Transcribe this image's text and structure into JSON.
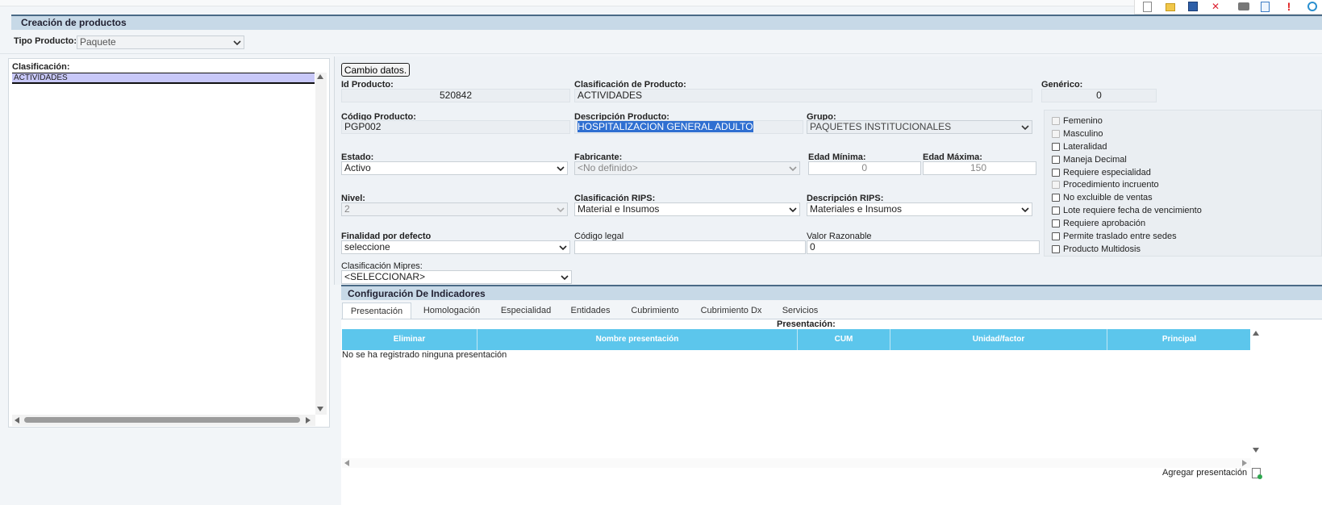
{
  "page": {
    "title": "Creación de productos",
    "tipo_producto_label": "Tipo Producto:",
    "tipo_producto_value": "Paquete"
  },
  "left_panel": {
    "header": "Clasificación:",
    "items": [
      "ACTIVIDADES"
    ]
  },
  "form": {
    "cambio_button": "Cambio datos.",
    "id_producto_label": "Id Producto:",
    "id_producto_value": "520842",
    "clasificacion_producto_label": "Clasificación de Producto:",
    "clasificacion_producto_value": "ACTIVIDADES",
    "generico_label": "Genérico:",
    "generico_value": "0",
    "codigo_label": "Código Producto:",
    "codigo_value": "PGP002",
    "descripcion_label": "Descripción Producto:",
    "descripcion_value": "HOSPITALIZACION GENERAL ADULTO",
    "grupo_label": "Grupo:",
    "grupo_value": "PAQUETES INSTITUCIONALES",
    "estado_label": "Estado:",
    "estado_value": "Activo",
    "fabricante_label": "Fabricante:",
    "fabricante_value": "<No definido>",
    "edad_min_label": "Edad Mínima:",
    "edad_min_value": "0",
    "edad_max_label": "Edad Máxima:",
    "edad_max_value": "150",
    "nivel_label": "Nivel:",
    "nivel_value": "2",
    "clasif_rips_label": "Clasificación RIPS:",
    "clasif_rips_value": "Material e Insumos",
    "desc_rips_label": "Descripción RIPS:",
    "desc_rips_value": "Materiales e Insumos",
    "finalidad_label": "Finalidad por defecto",
    "finalidad_value": "seleccione",
    "codigo_legal_label": "Código legal",
    "codigo_legal_value": "",
    "valor_razonable_label": "Valor Razonable",
    "valor_razonable_value": "0",
    "mipres_label": "Clasificación Mipres:",
    "mipres_value": "<SELECCIONAR>"
  },
  "checkboxes": [
    {
      "label": "Femenino",
      "disabled": true
    },
    {
      "label": "Masculino",
      "disabled": true
    },
    {
      "label": "Lateralidad",
      "disabled": false
    },
    {
      "label": "Maneja Decimal",
      "disabled": false
    },
    {
      "label": "Requiere especialidad",
      "disabled": false
    },
    {
      "label": "Procedimiento incruento",
      "disabled": true
    },
    {
      "label": "No excluible de ventas",
      "disabled": false
    },
    {
      "label": "Lote requiere fecha de vencimiento",
      "disabled": false
    },
    {
      "label": "Requiere aprobación",
      "disabled": false
    },
    {
      "label": "Permite traslado entre sedes",
      "disabled": false
    },
    {
      "label": "Producto Multidosis",
      "disabled": false
    }
  ],
  "indicadores": {
    "title": "Configuración De Indicadores",
    "tabs": [
      "Presentación",
      "Homologación",
      "Especialidad",
      "Entidades",
      "Cubrimiento",
      "Cubrimiento Dx",
      "Servicios"
    ],
    "section_title": "Presentación:",
    "columns": [
      "Eliminar",
      "Nombre presentación",
      "CUM",
      "Unidad/factor",
      "Principal"
    ],
    "empty_message": "No se ha registrado ninguna presentación",
    "add_label": "Agregar presentación"
  },
  "colors": {
    "title_bar": "#c7d9e7",
    "table_header": "#5cc6ec",
    "selection": "#c8c8f8"
  }
}
